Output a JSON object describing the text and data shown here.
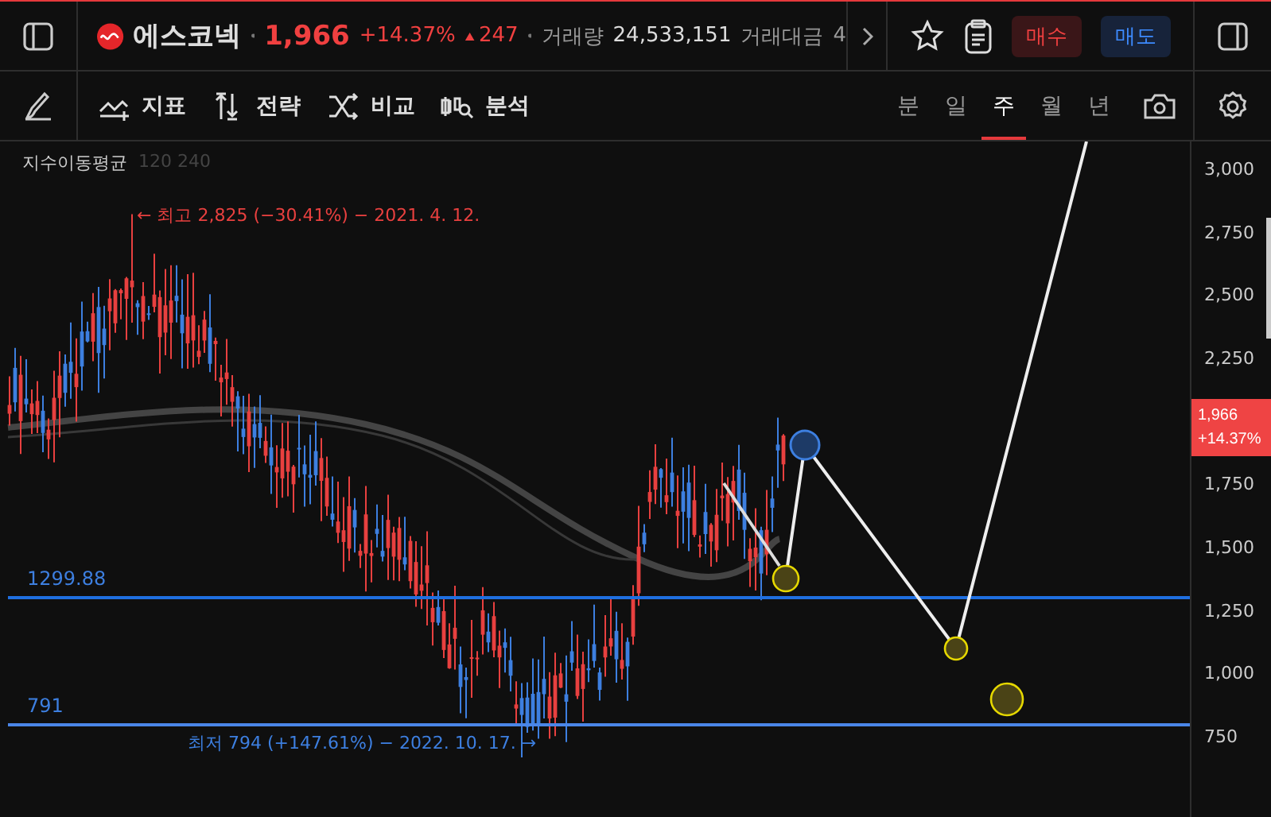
{
  "header": {
    "stock_name": "에스코넥",
    "price": "1,966",
    "change_pct": "+14.37%",
    "change_abs": "247",
    "volume_label": "거래량",
    "volume": "24,533,151",
    "value_label": "거래대금",
    "value": "4",
    "buy": "매수",
    "sell": "매도"
  },
  "toolbar": {
    "tools": [
      {
        "kind": "indicator",
        "label": "지표"
      },
      {
        "kind": "strategy",
        "label": "전략"
      },
      {
        "kind": "compare",
        "label": "비교"
      },
      {
        "kind": "analysis",
        "label": "분석"
      }
    ],
    "periods": [
      {
        "label": "분",
        "selected": false
      },
      {
        "label": "일",
        "selected": false
      },
      {
        "label": "주",
        "selected": true
      },
      {
        "label": "월",
        "selected": false
      },
      {
        "label": "년",
        "selected": false
      }
    ]
  },
  "chart": {
    "legend": {
      "name": "지수이동평균",
      "params": "120 240"
    },
    "high_note": "← 최고 2,825 (−30.41%) − 2021. 4. 12.",
    "low_note": "최저 794 (+147.61%) − 2022. 10. 17. →",
    "levels": [
      {
        "label": "1299.88"
      },
      {
        "label": "791"
      }
    ],
    "price_tag": {
      "price": "1,966",
      "change": "+14.37%"
    },
    "axis_ticks": [
      "3,000",
      "2,750",
      "2,500",
      "2,250",
      "1,750",
      "1,500",
      "1,250",
      "1,000",
      "750"
    ]
  }
}
